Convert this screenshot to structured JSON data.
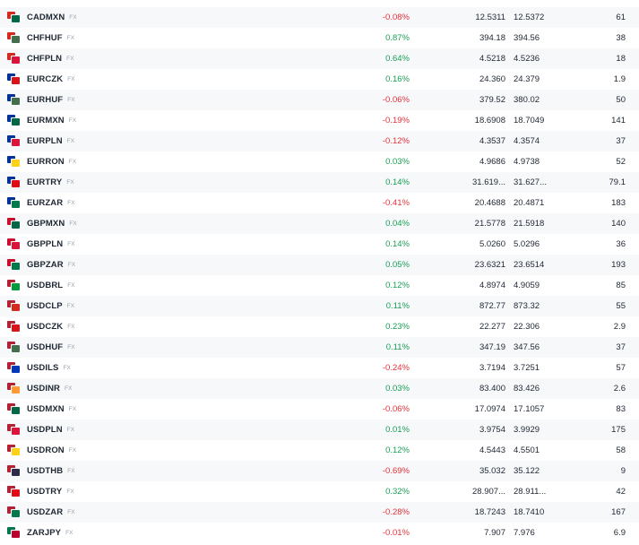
{
  "tag_label": "FX",
  "colors": {
    "positive": "#1b9e54",
    "negative": "#e5323b"
  },
  "rows": [
    {
      "symbol": "CADMXN",
      "change": "-0.08%",
      "dir": "down",
      "bid": "12.5311",
      "ask": "12.5372",
      "spread": "61",
      "flag": [
        "#d52b1e",
        "#006847"
      ]
    },
    {
      "symbol": "CHFHUF",
      "change": "0.87%",
      "dir": "up",
      "bid": "394.18",
      "ask": "394.56",
      "spread": "38",
      "flag": [
        "#d52b1e",
        "#436f4d"
      ]
    },
    {
      "symbol": "CHFPLN",
      "change": "0.64%",
      "dir": "up",
      "bid": "4.5218",
      "ask": "4.5236",
      "spread": "18",
      "flag": [
        "#d52b1e",
        "#dc143c"
      ]
    },
    {
      "symbol": "EURCZK",
      "change": "0.16%",
      "dir": "up",
      "bid": "24.360",
      "ask": "24.379",
      "spread": "1.9",
      "flag": [
        "#003399",
        "#d7141a"
      ]
    },
    {
      "symbol": "EURHUF",
      "change": "-0.06%",
      "dir": "down",
      "bid": "379.52",
      "ask": "380.02",
      "spread": "50",
      "flag": [
        "#003399",
        "#436f4d"
      ]
    },
    {
      "symbol": "EURMXN",
      "change": "-0.19%",
      "dir": "down",
      "bid": "18.6908",
      "ask": "18.7049",
      "spread": "141",
      "flag": [
        "#003399",
        "#006847"
      ]
    },
    {
      "symbol": "EURPLN",
      "change": "-0.12%",
      "dir": "down",
      "bid": "4.3537",
      "ask": "4.3574",
      "spread": "37",
      "flag": [
        "#003399",
        "#dc143c"
      ]
    },
    {
      "symbol": "EURRON",
      "change": "0.03%",
      "dir": "up",
      "bid": "4.9686",
      "ask": "4.9738",
      "spread": "52",
      "flag": [
        "#003399",
        "#fcd116"
      ]
    },
    {
      "symbol": "EURTRY",
      "change": "0.14%",
      "dir": "up",
      "bid": "31.619...",
      "ask": "31.627...",
      "spread": "79.1",
      "flag": [
        "#003399",
        "#e30a17"
      ]
    },
    {
      "symbol": "EURZAR",
      "change": "-0.41%",
      "dir": "down",
      "bid": "20.4688",
      "ask": "20.4871",
      "spread": "183",
      "flag": [
        "#003399",
        "#007a4d"
      ]
    },
    {
      "symbol": "GBPMXN",
      "change": "0.04%",
      "dir": "up",
      "bid": "21.5778",
      "ask": "21.5918",
      "spread": "140",
      "flag": [
        "#c8102e",
        "#006847"
      ]
    },
    {
      "symbol": "GBPPLN",
      "change": "0.14%",
      "dir": "up",
      "bid": "5.0260",
      "ask": "5.0296",
      "spread": "36",
      "flag": [
        "#c8102e",
        "#dc143c"
      ]
    },
    {
      "symbol": "GBPZAR",
      "change": "0.05%",
      "dir": "up",
      "bid": "23.6321",
      "ask": "23.6514",
      "spread": "193",
      "flag": [
        "#c8102e",
        "#007a4d"
      ]
    },
    {
      "symbol": "USDBRL",
      "change": "0.12%",
      "dir": "up",
      "bid": "4.8974",
      "ask": "4.9059",
      "spread": "85",
      "flag": [
        "#b22234",
        "#009c3b"
      ]
    },
    {
      "symbol": "USDCLP",
      "change": "0.11%",
      "dir": "up",
      "bid": "872.77",
      "ask": "873.32",
      "spread": "55",
      "flag": [
        "#b22234",
        "#d52b1e"
      ]
    },
    {
      "symbol": "USDCZK",
      "change": "0.23%",
      "dir": "up",
      "bid": "22.277",
      "ask": "22.306",
      "spread": "2.9",
      "flag": [
        "#b22234",
        "#d7141a"
      ]
    },
    {
      "symbol": "USDHUF",
      "change": "0.11%",
      "dir": "up",
      "bid": "347.19",
      "ask": "347.56",
      "spread": "37",
      "flag": [
        "#b22234",
        "#436f4d"
      ]
    },
    {
      "symbol": "USDILS",
      "change": "-0.24%",
      "dir": "down",
      "bid": "3.7194",
      "ask": "3.7251",
      "spread": "57",
      "flag": [
        "#b22234",
        "#0038b8"
      ]
    },
    {
      "symbol": "USDINR",
      "change": "0.03%",
      "dir": "up",
      "bid": "83.400",
      "ask": "83.426",
      "spread": "2.6",
      "flag": [
        "#b22234",
        "#ff9933"
      ]
    },
    {
      "symbol": "USDMXN",
      "change": "-0.06%",
      "dir": "down",
      "bid": "17.0974",
      "ask": "17.1057",
      "spread": "83",
      "flag": [
        "#b22234",
        "#006847"
      ]
    },
    {
      "symbol": "USDPLN",
      "change": "0.01%",
      "dir": "up",
      "bid": "3.9754",
      "ask": "3.9929",
      "spread": "175",
      "flag": [
        "#b22234",
        "#dc143c"
      ]
    },
    {
      "symbol": "USDRON",
      "change": "0.12%",
      "dir": "up",
      "bid": "4.5443",
      "ask": "4.5501",
      "spread": "58",
      "flag": [
        "#b22234",
        "#fcd116"
      ]
    },
    {
      "symbol": "USDTHB",
      "change": "-0.69%",
      "dir": "down",
      "bid": "35.032",
      "ask": "35.122",
      "spread": "9",
      "flag": [
        "#b22234",
        "#2d2a4a"
      ]
    },
    {
      "symbol": "USDTRY",
      "change": "0.32%",
      "dir": "up",
      "bid": "28.907...",
      "ask": "28.911...",
      "spread": "42",
      "flag": [
        "#b22234",
        "#e30a17"
      ]
    },
    {
      "symbol": "USDZAR",
      "change": "-0.28%",
      "dir": "down",
      "bid": "18.7243",
      "ask": "18.7410",
      "spread": "167",
      "flag": [
        "#b22234",
        "#007a4d"
      ]
    },
    {
      "symbol": "ZARJPY",
      "change": "-0.01%",
      "dir": "down",
      "bid": "7.907",
      "ask": "7.976",
      "spread": "6.9",
      "flag": [
        "#007a4d",
        "#bc002d"
      ]
    }
  ]
}
